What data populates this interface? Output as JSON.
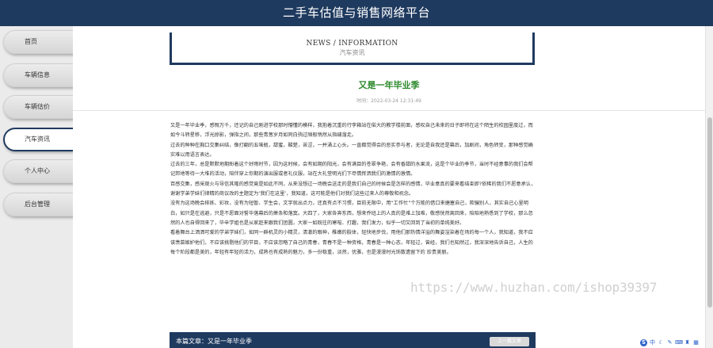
{
  "app": {
    "title": "二手车估值与销售网络平台"
  },
  "sidebar": {
    "items": [
      {
        "label": "首页"
      },
      {
        "label": "车辆信息"
      },
      {
        "label": "车辆估价"
      },
      {
        "label": "汽车资讯"
      },
      {
        "label": "个人中心"
      },
      {
        "label": "后台管理"
      }
    ],
    "active": "汽车资讯"
  },
  "section": {
    "title_en": "NEWS / INFORMATION",
    "title_cn": "汽车资讯"
  },
  "article": {
    "title": "又是一年毕业季",
    "time": "时间：2022-03-24 12:31:49",
    "paragraphs": [
      "又是一年毕业季，感慨万千，还记的自己刚进学校那时懵懂的模样，我抱着沉重的行李箱站在偌大的教学楼前面，感叹自己未来的日子即将在这个陌生的校园里度过，而如今斗转星移，浮光掠影，弹指之间，那些青葱岁月如同白驹过隙般悄然从指缝溜走。",
      "过去的种种在胸口交集纠结，像打翻的五味瓶，甜蜜，酸楚，苦涩，一并涌上心头。一直都觉得会的恶实参与者，无论是自我还是幕后，加剧间，角色转变，那种感觉确实难以用语言表达。",
      "过去的三年，总是默默地期盼着这个好雨时节，因为这时候，会有如期的阳光，会有满目的苍翠争艳，会有香甜的水果流，这是个毕业的季节，当时不经意事的我们会帮记邦地等待一大堆的活动，陪伴穿上你期的演出服或者礼仪服，站在大礼堂明光们下尽情挥洒我们的激情的激情。",
      "百感交集，感采观火与导信其隆的感觉竟是如此不同，从来没想过一场晚会送走的是我们自己的时候会是怎样的感情，毕业意真的要来看结束即?依稀的我们不愿意承认，谢谢学弟学妹们律精的商议改的主题定为‘我们在这里’，我知道，这可能是他们对我们这些过来人的尊敬和祝念。",
      "没有为这场晚会排练、彩妆，没有为短暂、学生会，文字就出点力，还真有点不习惯，目前无限中，用“工作忙”个万能的借口来搪塞自己，欺骗别人，其实自己心里明白，如只是在逃避，只是不愿面对誓毕落幕后的萧条和落寞。大四了，大家各奔东西，想来乔班上的人真的是难上加难，敬感恍然离回来，陪陪地熟悉到了学校，那么忽然的人也自得回来了，毕辛学姐也是从家赶来跟我们团圆，大家一如既往的寒暄、打趣，我们发力，似乎一切又回到了当初的单纯美好。",
      "看着舞台上洒洒可爱的学弟学妹们，如同一群机灵的小精灵，清澈的眼神，稚嫩的肢体，轻快地步伐，用他们那热情洋溢的舞姿渲染着在场的每一个人，我知道，我不应该羡慕嫉妒他们，不应该挑剔他们的节目，不应该忽略了自己的青春，青春不是一种资格，青春是一种心态，年轻过，曾经，我们也知然过，我深深地告诉自己，人生的每个阶段都是美的，年轻有年轻的活力，成熟也有成熟的魅力，多一份稳重，淡然，优雅，也是漫漫时光饰散遗留下的 珍贵美丽。"
    ]
  },
  "prev_nav": {
    "label": "本篇文章：又是一年毕业季",
    "button": "上一篇文章"
  },
  "watermark": {
    "text": "https://www.huzhan.com/ishop39397"
  },
  "tray": {
    "icons": [
      "s-logo-icon",
      "chinese-input-icon",
      "moon-icon",
      "comma-icon",
      "keyboard-icon",
      "shirt-icon",
      "grid-icon"
    ],
    "labels": [
      "S",
      "中",
      "☾",
      "✎",
      "⌨",
      "♜",
      "▦"
    ]
  },
  "colors": {
    "primary": "#1f3a5f",
    "title_green": "#2e8b2e"
  }
}
